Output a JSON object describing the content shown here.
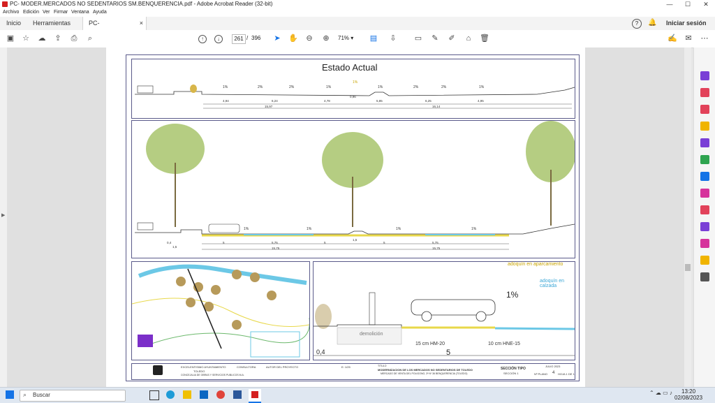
{
  "window": {
    "title": "PC- MODER.MERCADOS NO SEDENTARIOS SM.BENQUERENCIA.pdf - Adobe Acrobat Reader (32-bit)",
    "minimize": "—",
    "maximize": "☐",
    "close": "✕"
  },
  "menu": [
    "Archivo",
    "Edición",
    "Ver",
    "Firmar",
    "Ventana",
    "Ayuda"
  ],
  "tabs": {
    "home": "Inicio",
    "tools": "Herramientas",
    "document": "PC- MODER.MERC...",
    "document_close": "×",
    "signin": "Iniciar sesión"
  },
  "toolbar": {
    "page_current": "261",
    "page_separator": "/",
    "page_total": "396",
    "zoom": "71%"
  },
  "drawing": {
    "top_title": "Estado Actual",
    "slopes_top": [
      "1%",
      "2%",
      "2%",
      "1%",
      "1%",
      "1%",
      "2%",
      "2%",
      "1%"
    ],
    "dims_top": [
      "4,94",
      "6,24",
      "4,78",
      "0,96",
      "5,85",
      "6,25",
      "4,95"
    ],
    "totals_top": [
      "15,97",
      "16,14"
    ],
    "slopes_mid": [
      "1%",
      "1%",
      "1%",
      "1%"
    ],
    "dims_mid": [
      "0,4",
      "1,5",
      "5",
      "5,75",
      "5",
      "1,5",
      "5",
      "5,75"
    ],
    "totals_mid": [
      "15,75",
      "15,75"
    ],
    "detail": {
      "label_adoquin_aparc": "adoquín en aparcamiento",
      "label_adoquin_calzada": "adoquín en calzada",
      "slope": "1%",
      "demolicion": "demolición",
      "hm20": "15 cm HM-20",
      "hne15": "10 cm HNE-15",
      "dim_left": "0,4",
      "dim_main": "5"
    },
    "title_block": {
      "org": "EXCELENTISIMO AYUNTAMIENTO",
      "city": "TOLEDO",
      "dept": "CONCEJALIA DE OBRAS Y SERVICIOS PUBLICOS M.A.",
      "consultant": "CONSULTORA",
      "author": "AUTOR DEL PROYECTO",
      "project_label": "TITULO",
      "project": "MODERNIZACION DE LOS MERCADOS NO SEDENTARIOS DE TOLEDO",
      "project_sub": "MERCADO DE VENTA DEL POLIGONO, 3ª Nº 36 BENQUERENCIA (TOLEDO)",
      "plan_title": "SECCIÓN TIPO",
      "plan_sub": "SECCIÓN 1",
      "date": "JULIO 2023",
      "plan_no_label": "Nº PLANO",
      "plan_no": "4",
      "sheet": "HOJA 1 DE 1",
      "scale": "E: 1/25"
    }
  },
  "taskbar": {
    "search_placeholder": "Buscar",
    "time": "13:20",
    "date": "02/08/2023"
  },
  "colors": {
    "accent": "#1473e6",
    "acrobat_red": "#d41f1f",
    "tree_green": "#a8c46c",
    "pavement_yellow": "#e8d84a",
    "water_cyan": "#6cc8e6"
  }
}
